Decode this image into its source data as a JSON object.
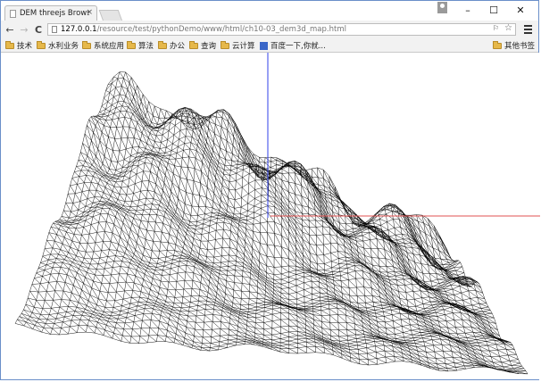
{
  "tab": {
    "title": "DEM threejs Browser",
    "close": "×"
  },
  "window_controls": {
    "minimize": "–",
    "maximize": "☐",
    "close": "✕"
  },
  "toolbar": {
    "back": "←",
    "forward": "→",
    "reload": "C",
    "url_host": "127.0.0.1",
    "url_path": "/resource/test/pythonDemo/www/html/ch10-03_dem3d_map.html",
    "translate": "⚐",
    "star": "☆"
  },
  "bookmarks": {
    "items": [
      "技术",
      "水利业务",
      "系统应用",
      "算法",
      "办公",
      "查询",
      "云计算",
      "百度一下,你就..."
    ],
    "other": "其他书签"
  },
  "scene": {
    "wire_color": "#000000",
    "axis_x_color": "#e05050",
    "axis_y_color": "#3040e8"
  }
}
